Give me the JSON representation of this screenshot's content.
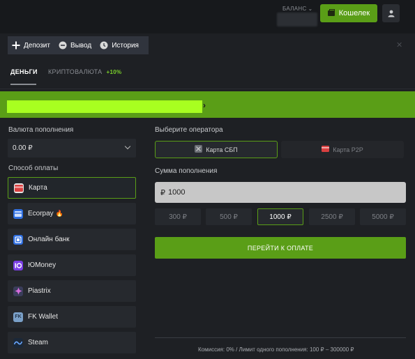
{
  "header": {
    "balance_label": "БАЛАНС",
    "wallet_button": "Кошелек"
  },
  "modal_tabs": [
    {
      "label": "Депозит",
      "icon": "plus-icon"
    },
    {
      "label": "Вывод",
      "icon": "minus-circle-icon"
    },
    {
      "label": "История",
      "icon": "clock-icon"
    }
  ],
  "sub_tabs": {
    "money": "ДЕНЬГИ",
    "crypto": "КРИПТОВАЛЮТА",
    "crypto_bonus": "+10%"
  },
  "left": {
    "currency_label": "Валюта пополнения",
    "currency_value": "0.00 ₽",
    "method_label": "Способ оплаты",
    "methods": [
      {
        "label": "Карта",
        "icon": "card-icon",
        "color": "#e34a4a"
      },
      {
        "label": "Ecorpay",
        "icon": "ecorpay-icon",
        "color": "#2f6fe0",
        "badge": "🔥"
      },
      {
        "label": "Онлайн банк",
        "icon": "bank-icon",
        "color": "#2f6fe0"
      },
      {
        "label": "ЮMoney",
        "icon": "yoomoney-icon",
        "color": "#7b3fe4"
      },
      {
        "label": "Piastrix",
        "icon": "piastrix-icon",
        "color": "#c44fd0"
      },
      {
        "label": "FK Wallet",
        "icon": "fk-wallet-icon",
        "color": "#7aa0c8"
      },
      {
        "label": "Steam",
        "icon": "steam-icon",
        "color": "#1b2838"
      }
    ]
  },
  "right": {
    "operator_label": "Выберите оператора",
    "operators": [
      {
        "label": "Карта СБП",
        "icon": "sbp-icon"
      },
      {
        "label": "Карта P2P",
        "icon": "p2p-card-icon"
      }
    ],
    "amount_label": "Сумма пополнения",
    "amount_currency": "₽",
    "amount_value": "1000",
    "presets": [
      "300 ₽",
      "500 ₽",
      "1000 ₽",
      "2500 ₽",
      "5000 ₽"
    ],
    "pay_button": "ПЕРЕЙТИ К ОПЛАТЕ",
    "footer_note": "Комиссия: 0%  /  Лимит одного пополнения: 100 ₽ – 300000 ₽"
  },
  "colors": {
    "accent": "#5a9e17",
    "accent_bright": "#a8ff20",
    "background": "#1e2024"
  }
}
